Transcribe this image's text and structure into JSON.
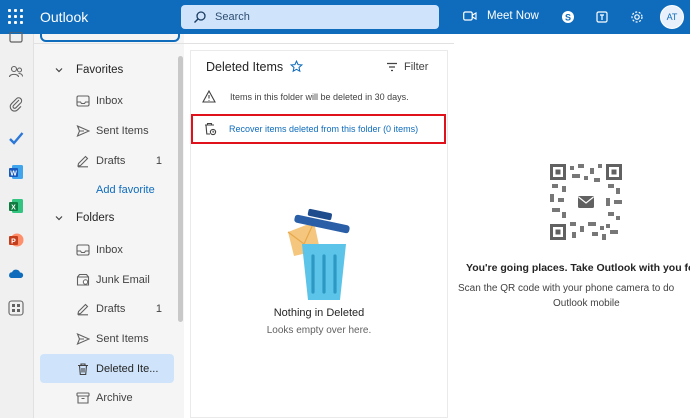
{
  "topbar": {
    "app_title": "Outlook",
    "search_placeholder": "Search",
    "meet_label": "Meet Now",
    "avatar_initials": "AT",
    "color": "#0f6cbd"
  },
  "nav": {
    "favorites": {
      "header": "Favorites",
      "items": [
        {
          "label": "Inbox",
          "count": "",
          "icon": "inbox-icon"
        },
        {
          "label": "Sent Items",
          "count": "",
          "icon": "send-icon"
        },
        {
          "label": "Drafts",
          "count": "1",
          "icon": "pencil-icon"
        }
      ],
      "add_favorite": "Add favorite"
    },
    "folders": {
      "header": "Folders",
      "items": [
        {
          "label": "Inbox",
          "count": "",
          "icon": "inbox-icon"
        },
        {
          "label": "Junk Email",
          "count": "",
          "icon": "junk-icon"
        },
        {
          "label": "Drafts",
          "count": "1",
          "icon": "pencil-icon"
        },
        {
          "label": "Sent Items",
          "count": "",
          "icon": "send-icon"
        },
        {
          "label": "Deleted Ite...",
          "count": "",
          "icon": "trash-icon",
          "selected": true
        },
        {
          "label": "Archive",
          "count": "",
          "icon": "archive-icon"
        }
      ]
    }
  },
  "list": {
    "title": "Deleted Items",
    "filter_label": "Filter",
    "warning_text": "Items in this folder will be deleted in 30 days.",
    "recover_text": "Recover items deleted from this folder (0 items)",
    "empty_title": "Nothing in Deleted",
    "empty_subtitle": "Looks empty over here."
  },
  "reading": {
    "promo_title": "You're going places. Take Outlook with you fo",
    "promo_line1": "Scan the QR code with your phone camera to do",
    "promo_line2": "Outlook mobile"
  }
}
